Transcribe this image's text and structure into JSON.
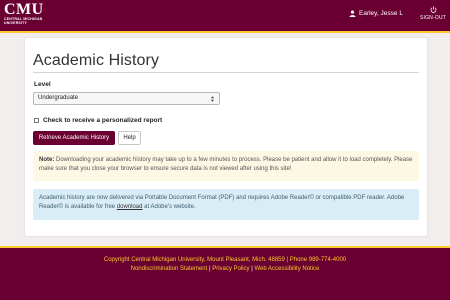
{
  "header": {
    "logo_main": "CMU",
    "logo_sub": "Central Michigan University",
    "user_name": "Earley, Jesse L",
    "user_icon": "person-icon",
    "signout_label": "SIGN-OUT",
    "signout_icon": "power-icon"
  },
  "main": {
    "title": "Academic History",
    "level_label": "Level",
    "level_value": "Undergraduate",
    "checkbox_label": "Check to receive a personalized report",
    "checkbox_checked": false,
    "retrieve_button": "Retrieve Academic History",
    "help_button": "Help",
    "note_label": "Note:",
    "note_text": "Downloading your academic history may take up to a few minutes to process. Please be patient and allow it to load completely. Please make sure that you close your browser to ensure secure data is not viewed after using this site!",
    "info_text_1": "Academic history are now delivered via Portable Document Format (PDF) and requires Adobe Reader© or compatible PDF reader. Adobe Reader© is available for free",
    "info_link": "download",
    "info_text_2": "at Adobe's website."
  },
  "footer": {
    "copyright_label": "Copyright",
    "address": "Central Michigan University, Mount Pleasant, Mich. 48859 | Phone 989-774-4000",
    "link_nondiscrimination": "Nondiscrimination Statement",
    "link_privacy": "Privacy Policy",
    "link_accessibility": "Web Accessibility Notice",
    "separator": "|"
  },
  "colors": {
    "brand_maroon": "#6a0032",
    "brand_gold": "#ffc82e",
    "note_bg": "#fcf8e3",
    "info_bg": "#d9edf7"
  }
}
